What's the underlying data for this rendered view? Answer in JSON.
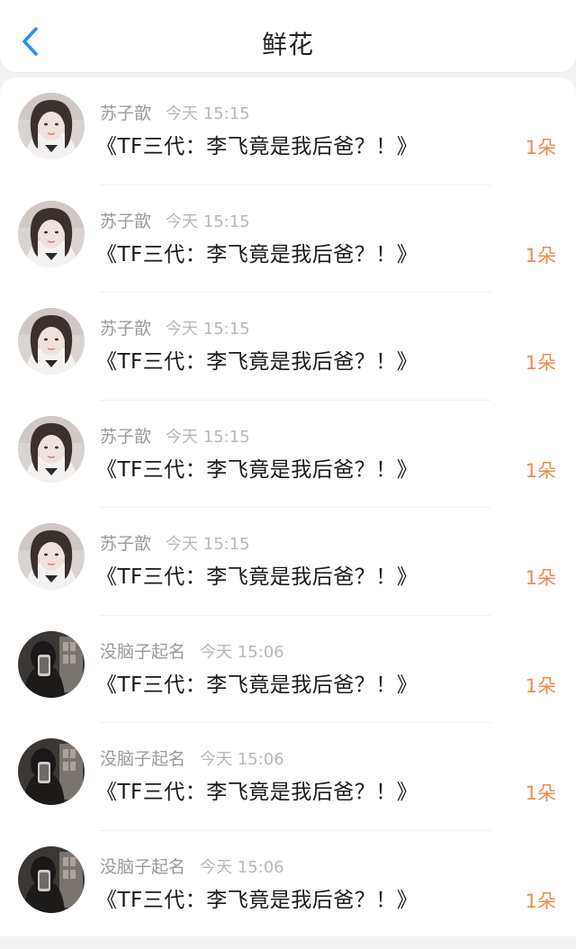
{
  "header": {
    "title": "鲜花"
  },
  "colors": {
    "accent": "#2d8ff0",
    "count": "#f08a4b"
  },
  "items": [
    {
      "name": "苏子歆",
      "time": "今天 15:15",
      "book": "《TF三代：李飞竟是我后爸？！》",
      "count": "1朵",
      "avatar": "girl"
    },
    {
      "name": "苏子歆",
      "time": "今天 15:15",
      "book": "《TF三代：李飞竟是我后爸？！》",
      "count": "1朵",
      "avatar": "girl"
    },
    {
      "name": "苏子歆",
      "time": "今天 15:15",
      "book": "《TF三代：李飞竟是我后爸？！》",
      "count": "1朵",
      "avatar": "girl"
    },
    {
      "name": "苏子歆",
      "time": "今天 15:15",
      "book": "《TF三代：李飞竟是我后爸？！》",
      "count": "1朵",
      "avatar": "girl"
    },
    {
      "name": "苏子歆",
      "time": "今天 15:15",
      "book": "《TF三代：李飞竟是我后爸？！》",
      "count": "1朵",
      "avatar": "girl"
    },
    {
      "name": "没脑子起名",
      "time": "今天 15:06",
      "book": "《TF三代：李飞竟是我后爸？！》",
      "count": "1朵",
      "avatar": "dark"
    },
    {
      "name": "没脑子起名",
      "time": "今天 15:06",
      "book": "《TF三代：李飞竟是我后爸？！》",
      "count": "1朵",
      "avatar": "dark"
    },
    {
      "name": "没脑子起名",
      "time": "今天 15:06",
      "book": "《TF三代：李飞竟是我后爸？！》",
      "count": "1朵",
      "avatar": "dark"
    }
  ]
}
